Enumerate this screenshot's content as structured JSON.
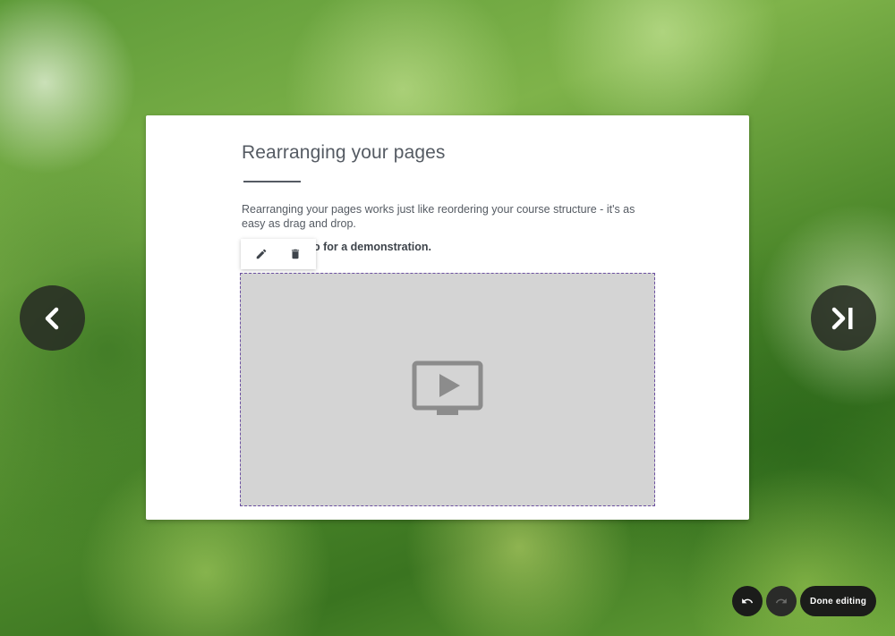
{
  "page": {
    "title": "Rearranging your pages",
    "intro": "Rearranging your pages works just like reordering your course structure - it's as easy as drag and drop.",
    "instruction_visible": "o for a demonstration."
  },
  "block_toolbar": {
    "edit_icon": "pencil-icon",
    "delete_icon": "trash-icon"
  },
  "video_block": {
    "icon": "video-placeholder-icon"
  },
  "navigation": {
    "prev_icon": "chevron-left-icon",
    "next_icon": "skip-next-icon"
  },
  "editing": {
    "undo_icon": "undo-icon",
    "redo_icon": "redo-icon",
    "done_label": "Done editing"
  },
  "colors": {
    "text": "#555b63",
    "selection_border": "#6b4fa0",
    "placeholder_bg": "#d4d4d4",
    "dark_button": "#1b1c1a"
  }
}
